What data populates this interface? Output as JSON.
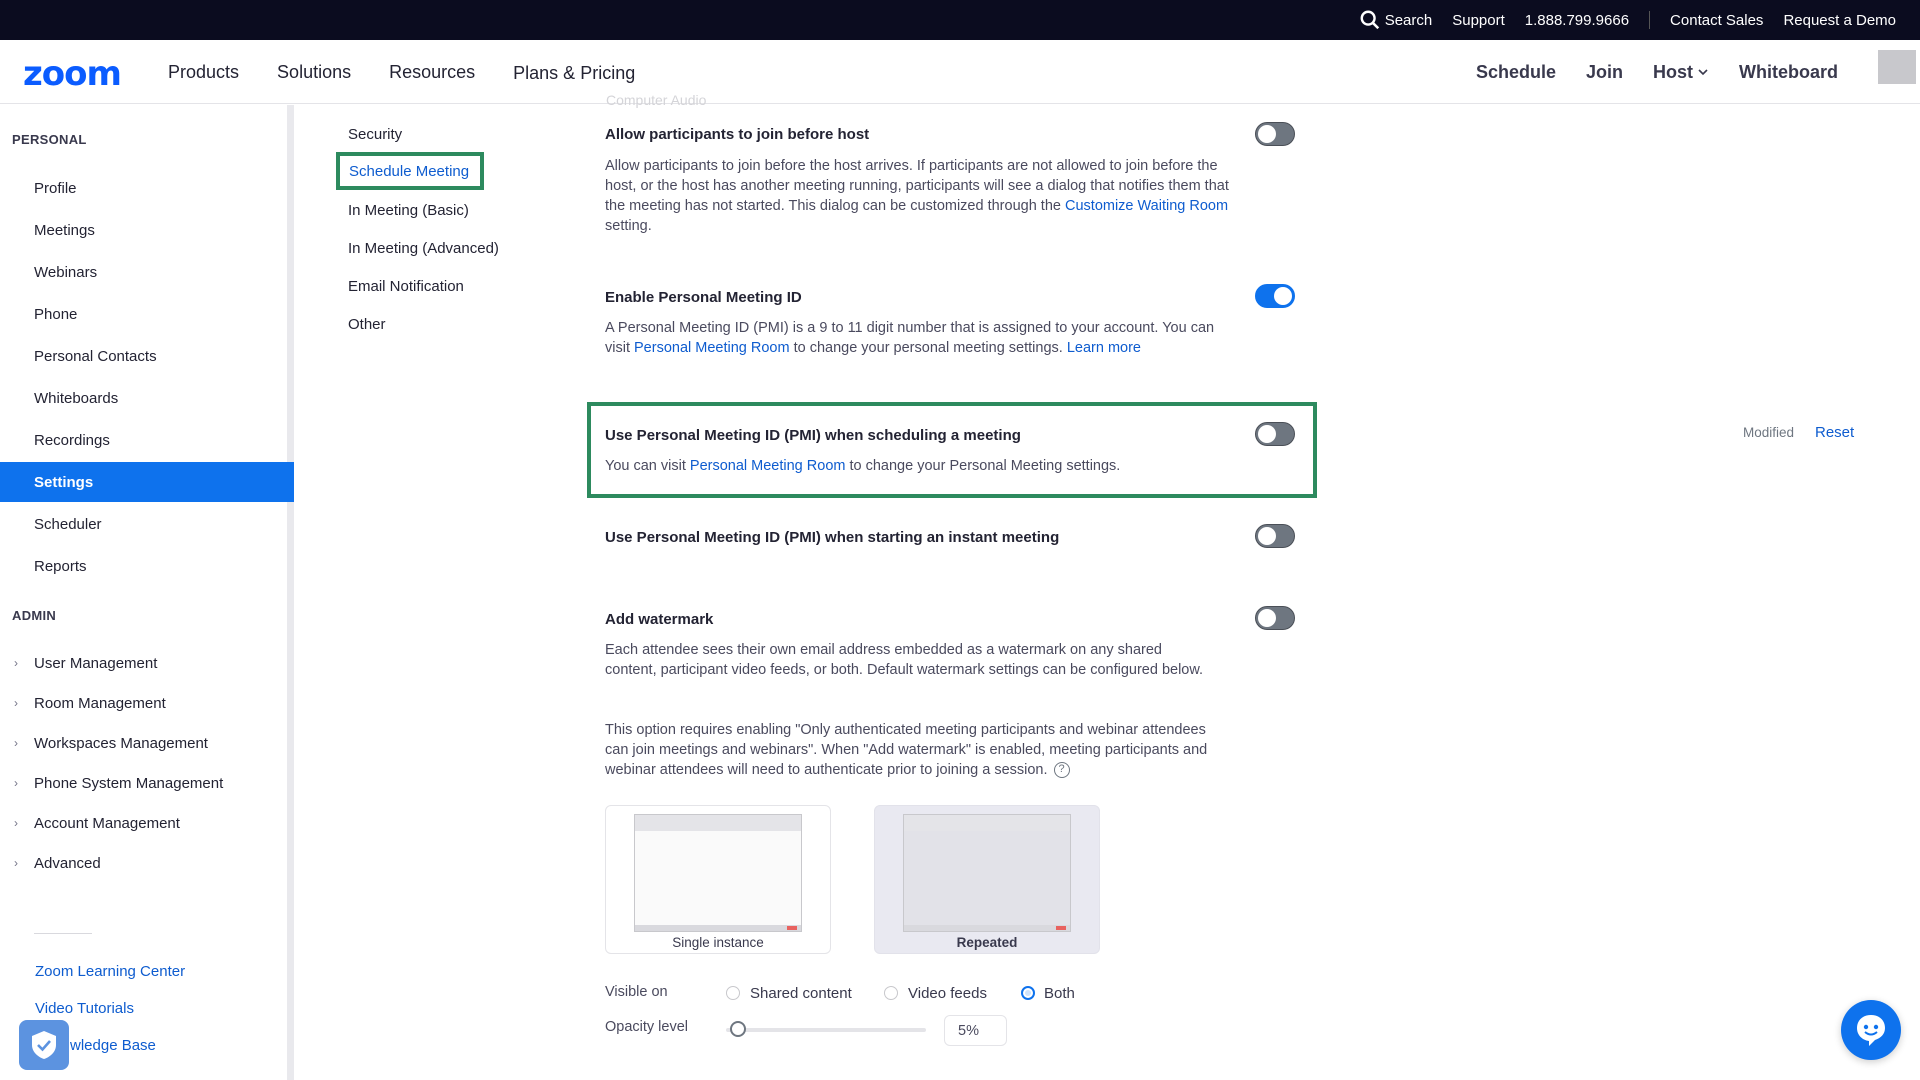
{
  "topbar": {
    "search": "Search",
    "support": "Support",
    "phone": "1.888.799.9666",
    "contact_sales": "Contact Sales",
    "request_demo": "Request a Demo"
  },
  "nav": {
    "logo": "zoom",
    "ghost_option": "Computer Audio",
    "left": [
      "Products",
      "Solutions",
      "Resources",
      "Plans & Pricing"
    ],
    "right": {
      "schedule": "Schedule",
      "join": "Join",
      "host": "Host",
      "whiteboard": "Whiteboard"
    }
  },
  "sidebar": {
    "personal_heading": "PERSONAL",
    "personal_items": [
      "Profile",
      "Meetings",
      "Webinars",
      "Phone",
      "Personal Contacts",
      "Whiteboards",
      "Recordings",
      "Settings",
      "Scheduler",
      "Reports"
    ],
    "active": "Settings",
    "admin_heading": "ADMIN",
    "admin_items": [
      "User Management",
      "Room Management",
      "Workspaces Management",
      "Phone System Management",
      "Account Management",
      "Advanced"
    ],
    "links": [
      "Zoom Learning Center",
      "Video Tutorials",
      "Knowledge Base"
    ],
    "knowledge_visible": "wledge Base"
  },
  "subnav": {
    "items": [
      "Security",
      "Schedule Meeting",
      "In Meeting (Basic)",
      "In Meeting (Advanced)",
      "Email Notification",
      "Other"
    ],
    "active": "Schedule Meeting"
  },
  "settings": {
    "jbh": {
      "title": "Allow participants to join before host",
      "desc": "Allow participants to join before the host arrives. If participants are not allowed to join before the host, or the host has another meeting running, participants will see a dialog that notifies them that the meeting has not started. This dialog can be customized through the ",
      "link": "Customize Waiting Room",
      "desc_end": " setting.",
      "enabled": false
    },
    "pmi": {
      "title": "Enable Personal Meeting ID",
      "desc": "A Personal Meeting ID (PMI) is a 9 to 11 digit number that is assigned to your account. You can visit ",
      "link": "Personal Meeting Room",
      "desc_mid": " to change your personal meeting settings. ",
      "link2": "Learn more",
      "enabled": true
    },
    "pmi_schedule": {
      "title": "Use Personal Meeting ID (PMI) when scheduling a meeting",
      "desc": "You can visit ",
      "link": "Personal Meeting Room",
      "desc_end": " to change your Personal Meeting settings.",
      "enabled": false,
      "modified": "Modified",
      "reset": "Reset"
    },
    "pmi_instant": {
      "title": "Use Personal Meeting ID (PMI) when starting an instant meeting",
      "enabled": false
    },
    "watermark": {
      "title": "Add watermark",
      "desc1": "Each attendee sees their own email address embedded as a watermark on any shared content, participant video feeds, or both. Default watermark settings can be configured below.",
      "desc2": "This option requires enabling \"Only authenticated meeting participants and webinar attendees can join meetings and webinars\". When \"Add watermark\" is enabled, meeting participants and webinar attendees will need to authenticate prior to joining a session.",
      "enabled": false,
      "options": [
        "Single instance",
        "Repeated"
      ],
      "selected_option": "Repeated",
      "visible_on_label": "Visible on",
      "visible_on": [
        "Shared content",
        "Video feeds",
        "Both"
      ],
      "visible_selected": "Both",
      "opacity_label": "Opacity level",
      "opacity_value": "5%",
      "opacity_level": 0.05
    }
  },
  "colors": {
    "accent": "#0e72ed",
    "highlight_border": "#2d8a5e",
    "topbar_bg": "#0b0c1f"
  }
}
